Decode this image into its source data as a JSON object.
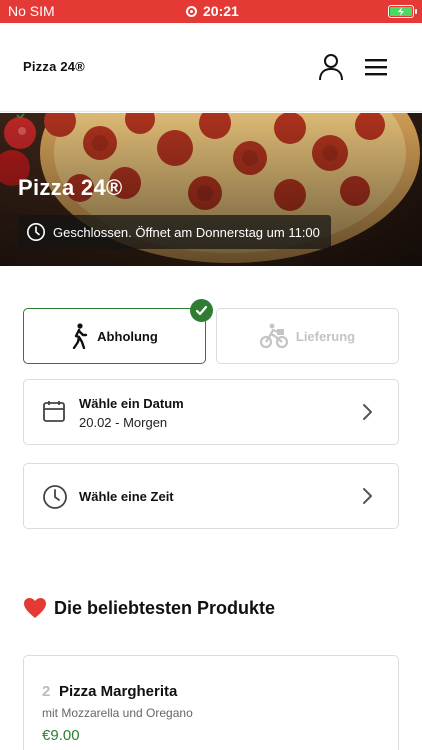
{
  "status_bar": {
    "carrier": "No SIM",
    "time": "20:21",
    "battery_icon": "battery-charging-icon"
  },
  "header": {
    "brand": "Pizza 24®",
    "icons": [
      "user-icon",
      "hamburger-menu-icon"
    ]
  },
  "hero": {
    "title": "Pizza 24®",
    "status_text": "Geschlossen. Öffnet am Donnerstag um 11:00",
    "status_icon": "clock-icon"
  },
  "order_mode": {
    "pickup_label": "Abholung",
    "delivery_label": "Lieferung",
    "selected": "pickup"
  },
  "date_selector": {
    "title": "Wähle ein Datum",
    "value": "20.02 - Morgen"
  },
  "time_selector": {
    "title": "Wähle eine Zeit"
  },
  "popular": {
    "title": "Die beliebtesten Produkte",
    "icon": "heart-icon",
    "products": [
      {
        "number": "2",
        "name": "Pizza Margherita",
        "description": "mit Mozzarella und Oregano",
        "price": "€9.00"
      }
    ]
  },
  "colors": {
    "accent_green": "#2e7d32",
    "status_bar_red": "#e53935",
    "heart_red": "#e53935"
  }
}
